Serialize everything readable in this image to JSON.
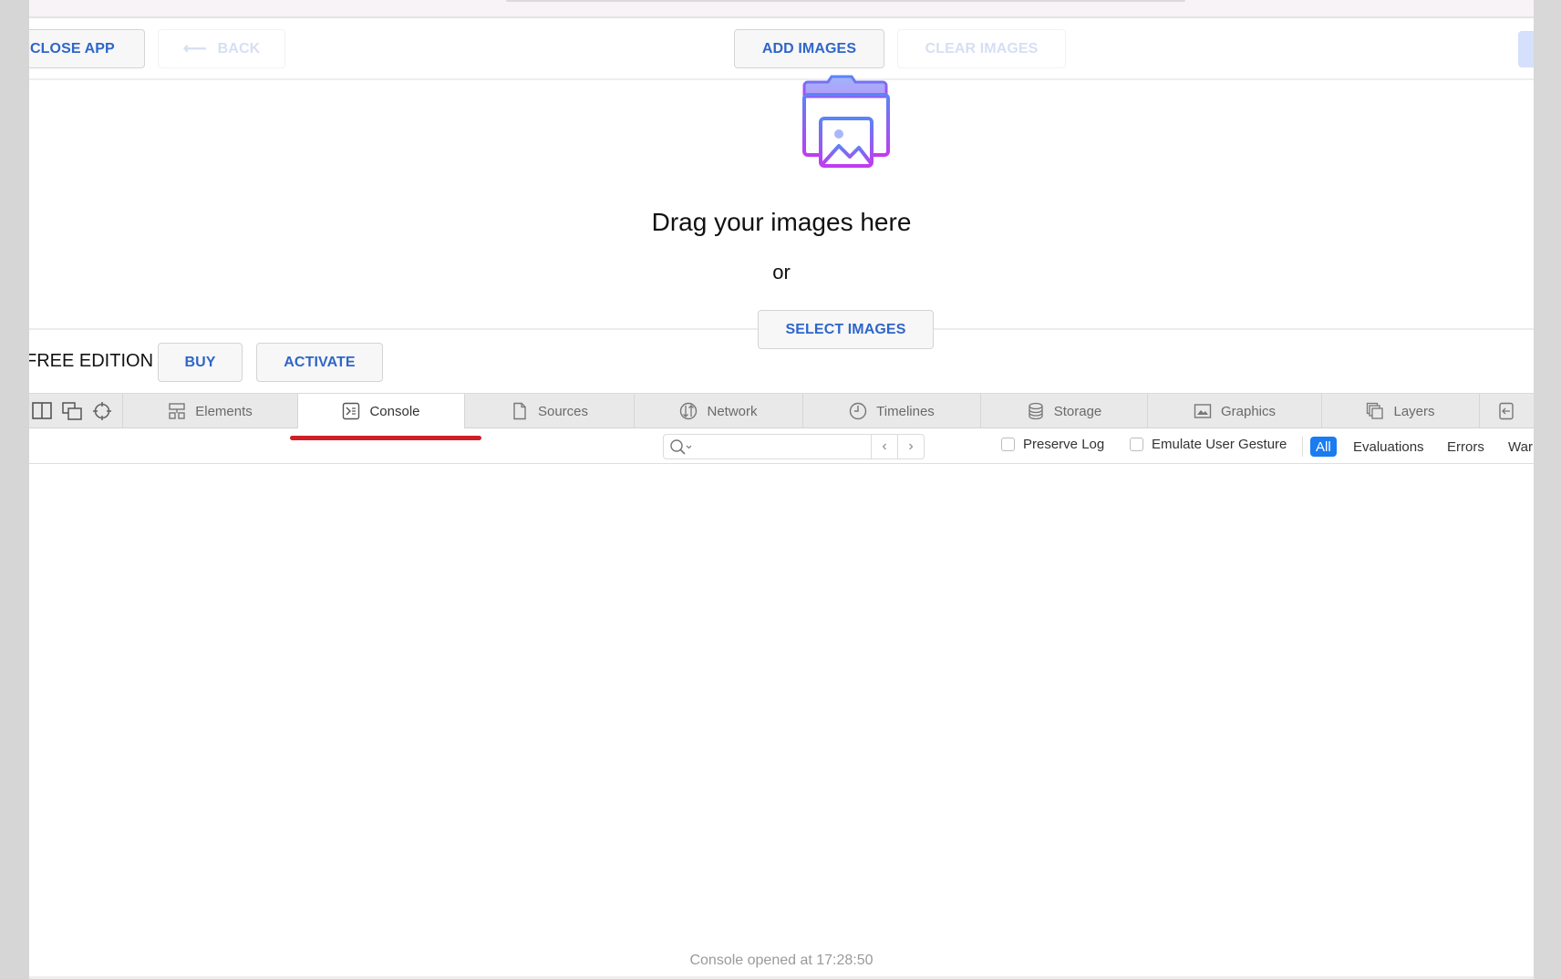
{
  "toolbar": {
    "close_app": "CLOSE APP",
    "back": "BACK",
    "add_images": "ADD IMAGES",
    "clear_images": "CLEAR IMAGES"
  },
  "dropzone": {
    "title": "Drag your images here",
    "or": "or",
    "select_images": "SELECT IMAGES",
    "icon": "folder-image-icon",
    "icon_gradient": [
      "#5b84f5",
      "#c03cf0"
    ]
  },
  "edition": {
    "label": "FREE EDITION",
    "buy": "BUY",
    "activate": "ACTIVATE"
  },
  "devtools": {
    "tool_icons": [
      "dock-side-icon",
      "detach-window-icon",
      "inspect-target-icon"
    ],
    "tabs": [
      {
        "label": "Elements",
        "icon": "elements-icon",
        "active": false
      },
      {
        "label": "Console",
        "icon": "console-icon",
        "active": true
      },
      {
        "label": "Sources",
        "icon": "sources-icon",
        "active": false
      },
      {
        "label": "Network",
        "icon": "network-icon",
        "active": false
      },
      {
        "label": "Timelines",
        "icon": "timelines-icon",
        "active": false
      },
      {
        "label": "Storage",
        "icon": "storage-icon",
        "active": false
      },
      {
        "label": "Graphics",
        "icon": "graphics-icon",
        "active": false
      },
      {
        "label": "Layers",
        "icon": "layers-icon",
        "active": false
      }
    ],
    "filter": {
      "search_value": "",
      "preserve_log": {
        "label": "Preserve Log",
        "checked": false
      },
      "emulate_gesture": {
        "label": "Emulate User Gesture",
        "checked": false
      },
      "levels": [
        {
          "label": "All",
          "active": true
        },
        {
          "label": "Evaluations",
          "active": false
        },
        {
          "label": "Errors",
          "active": false
        },
        {
          "label": "War",
          "active": false
        }
      ]
    },
    "console_status": "Console opened at 17:28:50"
  },
  "colors": {
    "accent_blue": "#2f66c9",
    "active_filter": "#1a7cf0",
    "annotation_red": "#cf1f26"
  }
}
